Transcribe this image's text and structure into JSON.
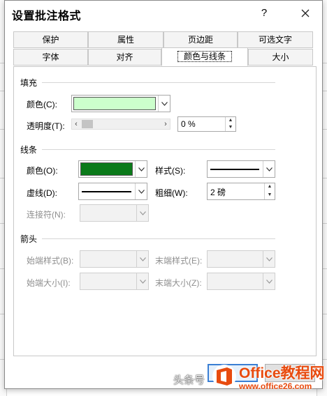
{
  "dialog": {
    "title": "设置批注格式",
    "help": "?",
    "close": "✕"
  },
  "tabs": {
    "row_back": [
      "保护",
      "属性",
      "页边距",
      "可选文字"
    ],
    "row_front": [
      "字体",
      "对齐",
      "颜色与线条",
      "大小"
    ],
    "active": "颜色与线条"
  },
  "fill": {
    "heading": "填充",
    "color_label": "颜色(C):",
    "color_value": "#ccffcc",
    "transparency_label": "透明度(T):",
    "transparency_value": "0 %"
  },
  "line": {
    "heading": "线条",
    "color_label": "颜色(O):",
    "color_value": "#0b7a1a",
    "style_label": "样式(S):",
    "dash_label": "虚线(D):",
    "weight_label": "粗细(W):",
    "weight_value": "2 磅",
    "connector_label": "连接符(N):"
  },
  "arrows": {
    "heading": "箭头",
    "begin_style": "始端样式(B):",
    "end_style": "末端样式(E):",
    "begin_size": "始端大小(I):",
    "end_size": "末端大小(Z):"
  },
  "watermark": {
    "text": "头条号",
    "brand": "Office教程网",
    "url": "www.office26.com"
  }
}
